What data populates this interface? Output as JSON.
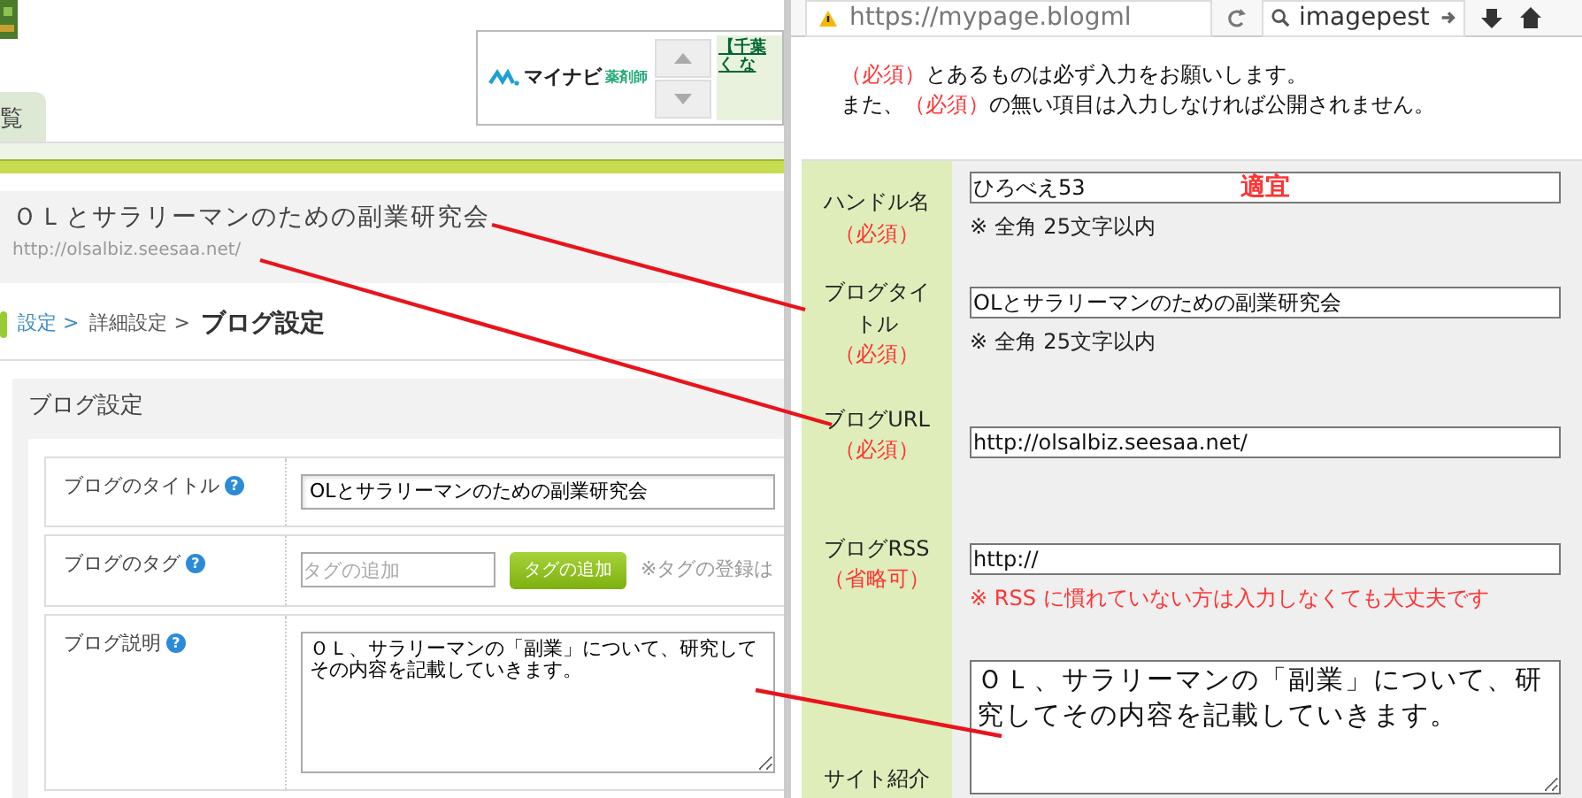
{
  "left_page": {
    "tab": {
      "label": "覧"
    },
    "ad": {
      "logo_text": "マイナビ",
      "logo_sub": "薬剤師",
      "text_lines": [
        "【千葉",
        "く な"
      ]
    },
    "blog_header": {
      "title": "ＯＬとサラリーマンのための副業研究会",
      "url": "http://olsalbiz.seesaa.net/"
    },
    "breadcrumb": [
      {
        "label": "設定 >",
        "kind": "link"
      },
      {
        "label": "詳細設定 >",
        "kind": "text"
      },
      {
        "label": "ブログ設定",
        "kind": "current"
      }
    ],
    "settings_panel": {
      "title": "ブログ設定",
      "rows": [
        {
          "label": "ブログのタイトル",
          "help": "?",
          "kind": "text",
          "value": "OLとサラリーマンのための副業研究会"
        },
        {
          "label": "ブログのタグ",
          "help": "?",
          "kind": "tags",
          "placeholder": "タグの追加",
          "button": "タグの追加",
          "note": "※タグの登録は"
        },
        {
          "label": "ブログ説明",
          "help": "?",
          "kind": "textarea",
          "value": "ＯＬ、サラリーマンの「副業」について、研究してその内容を記載していきます。"
        }
      ]
    }
  },
  "right_page": {
    "browser": {
      "url": "https://mypage.blogml",
      "search": "imagepest"
    },
    "notice": [
      [
        {
          "text": "（必須）",
          "kind": "marker"
        },
        {
          "text": "とあるものは必ず入力をお願いします。",
          "kind": "plain"
        }
      ],
      [
        {
          "text": "また、",
          "kind": "plain"
        },
        {
          "text": "（必須）",
          "kind": "marker"
        },
        {
          "text": "の無い項目は入力しなければ公開されません。",
          "kind": "plain"
        }
      ]
    ],
    "form_rows": [
      {
        "label": "ハンドル名",
        "marker": "（必須）",
        "kind": "text",
        "value": "ひろべえ53",
        "annotation": "適宜",
        "hint": "※ 全角 25文字以内",
        "warning": false
      },
      {
        "label": "ブログタイトル",
        "marker": "（必須）",
        "kind": "text",
        "value": "OLとサラリーマンのための副業研究会",
        "hint": "※ 全角 25文字以内",
        "warning": false
      },
      {
        "label": "ブログURL",
        "marker": "（必須）",
        "kind": "text",
        "value": "http://olsalbiz.seesaa.net/"
      },
      {
        "label": "ブログRSS",
        "marker": "（省略可）",
        "kind": "text",
        "value": "http://",
        "hint": "※ RSS に慣れていない方は入力しなくても大丈夫です",
        "warning": true
      },
      {
        "label": "サイト紹介",
        "kind": "textarea",
        "value": "ＯＬ、サラリーマンの「副業」について、研究してその内容を記載していきます。"
      }
    ]
  }
}
